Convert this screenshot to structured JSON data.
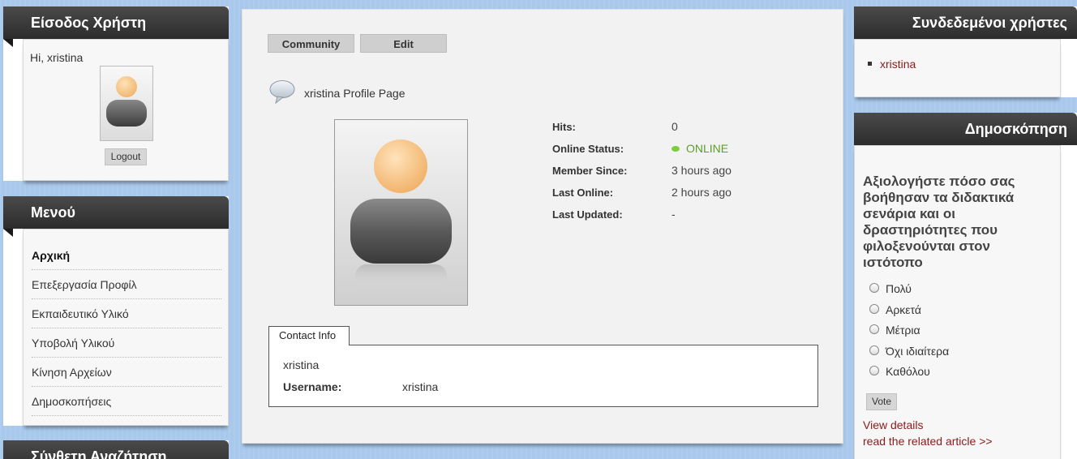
{
  "login": {
    "title": "Είσοδος Χρήστη",
    "greeting": "Hi, xristina",
    "logout_label": "Logout"
  },
  "menu": {
    "title": "Μενού",
    "items": [
      {
        "label": "Αρχική",
        "active": true
      },
      {
        "label": "Επεξεργασία Προφίλ"
      },
      {
        "label": "Εκπαιδευτικό Υλικό"
      },
      {
        "label": "Υποβολή Υλικού"
      },
      {
        "label": "Κίνηση Αρχείων"
      },
      {
        "label": "Δημοσκοπήσεις"
      }
    ]
  },
  "search_module": {
    "title": "Σύνθετη Αναζήτηση"
  },
  "main": {
    "tabs": {
      "community": "Community",
      "edit": "Edit"
    },
    "profile_title": "xristina Profile Page",
    "info": [
      {
        "label": "Hits:",
        "value": "0"
      },
      {
        "label": "Online Status:",
        "value": "ONLINE"
      },
      {
        "label": "Member Since:",
        "value": "3 hours ago"
      },
      {
        "label": "Last Online:",
        "value": "2 hours ago"
      },
      {
        "label": "Last Updated:",
        "value": "-"
      }
    ],
    "contact": {
      "tab_label": "Contact Info",
      "name": "xristina",
      "username_label": "Username:",
      "username_value": "xristina"
    }
  },
  "online_users": {
    "title": "Συνδεδεμένοι χρήστες",
    "users": [
      "xristina"
    ]
  },
  "poll": {
    "title": "Δημοσκόπηση",
    "question": "Αξιολογήστε πόσο σας βοήθησαν τα διδακτικά σενάρια και οι δραστηριότητες που φιλοξενούνται στον ιστότοπο",
    "options": [
      "Πολύ",
      "Αρκετά",
      "Μέτρια",
      "Όχι ιδιαίτερα",
      "Καθόλου"
    ],
    "vote_label": "Vote",
    "view_details": "View details",
    "related_link": "read the related article >>"
  },
  "colors": {
    "page_bg": "#a9c9ec",
    "header_bg": "#3a3a3a",
    "link": "#8b1a1a",
    "online_green": "#5aa02c"
  }
}
